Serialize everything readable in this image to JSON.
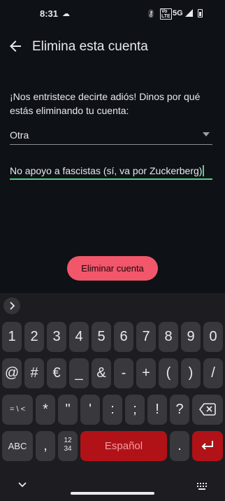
{
  "status_bar": {
    "time": "8:31",
    "network": "5G",
    "volte": "Vo LTE"
  },
  "app_bar": {
    "title": "Elimina esta cuenta"
  },
  "form": {
    "prompt": "¡Nos entristece decirte adiós! Dinos por qué estás eliminando tu cuenta:",
    "reason_selected": "Otra",
    "comment_value": "No apoyo a fascistas (sí, va por Zuckerberg)",
    "delete_label": "Eliminar cuenta"
  },
  "keyboard": {
    "row1": [
      "1",
      "2",
      "3",
      "4",
      "5",
      "6",
      "7",
      "8",
      "9",
      "0"
    ],
    "row2": [
      "@",
      "#",
      "€",
      "_",
      "&",
      "-",
      "+",
      "(",
      ")",
      "/"
    ],
    "row3": [
      "= \\ <",
      "*",
      "\"",
      "'",
      ":",
      ";",
      "!",
      "?"
    ],
    "row4": {
      "abc": "ABC",
      "comma": ",",
      "numpad": "12\n34",
      "space": "Español",
      "period": "."
    }
  },
  "colors": {
    "background": "#0e1116",
    "accent_green": "#4fd18a",
    "delete_button": "#f2566a",
    "keyboard_accent": "#b01218"
  }
}
